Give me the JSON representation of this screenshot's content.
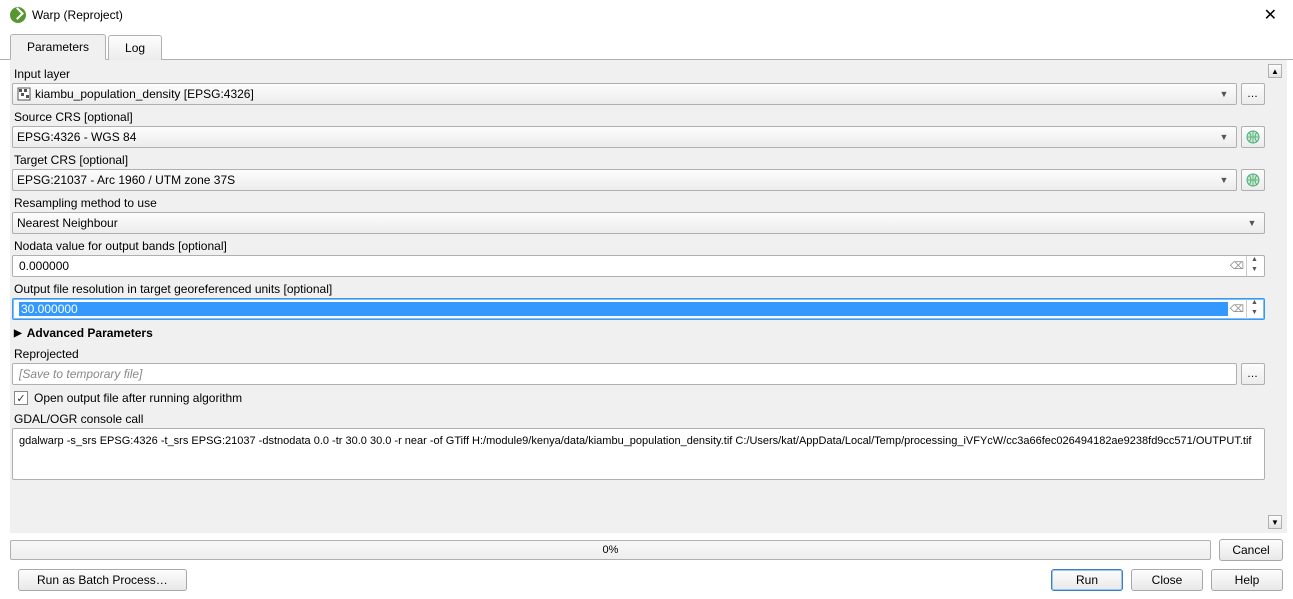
{
  "title": "Warp (Reproject)",
  "tabs": {
    "parameters": "Parameters",
    "log": "Log"
  },
  "labels": {
    "input_layer": "Input layer",
    "source_crs": "Source CRS [optional]",
    "target_crs": "Target CRS [optional]",
    "resampling": "Resampling method to use",
    "nodata": "Nodata value for output bands [optional]",
    "resolution": "Output file resolution in target georeferenced units [optional]",
    "advanced": "Advanced Parameters",
    "reprojected": "Reprojected",
    "open_output": "Open output file after running algorithm",
    "console": "GDAL/OGR console call"
  },
  "values": {
    "input_layer": "kiambu_population_density [EPSG:4326]",
    "source_crs": "EPSG:4326 - WGS 84",
    "target_crs": "EPSG:21037 - Arc 1960 / UTM zone 37S",
    "resampling": "Nearest Neighbour",
    "nodata": "0.000000",
    "resolution": "30.000000",
    "reprojected_placeholder": "[Save to temporary file]",
    "console_call": "gdalwarp -s_srs EPSG:4326 -t_srs EPSG:21037 -dstnodata 0.0 -tr 30.0 30.0 -r near -of GTiff H:/module9/kenya/data/kiambu_population_density.tif C:/Users/kat/AppData/Local/Temp/processing_iVFYcW/cc3a66fec026494182ae9238fd9cc571/OUTPUT.tif"
  },
  "progress": "0%",
  "buttons": {
    "cancel": "Cancel",
    "batch": "Run as Batch Process…",
    "run": "Run",
    "close": "Close",
    "help": "Help",
    "browse": "…"
  }
}
